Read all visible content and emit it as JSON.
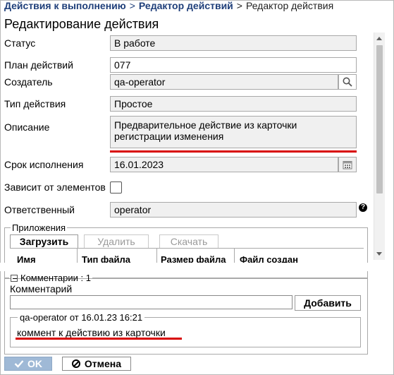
{
  "breadcrumb": {
    "item1": "Действия к выполнению",
    "item2": "Редактор действий",
    "current": "Редактор действия",
    "separator": ">"
  },
  "page_title": "Редактирование действия",
  "form": {
    "status": {
      "label": "Статус",
      "value": "В работе"
    },
    "plan": {
      "label": "План действий",
      "value": "077"
    },
    "creator": {
      "label": "Создатель",
      "value": "qa-operator"
    },
    "action_type": {
      "label": "Тип действия",
      "value": "Простое"
    },
    "description": {
      "label": "Описание",
      "value": "Предварительное действие из карточки регистрации изменения"
    },
    "due_date": {
      "label": "Срок исполнения",
      "value": "16.01.2023"
    },
    "depends": {
      "label": "Зависит от элементов",
      "checked": false
    },
    "responsible": {
      "label": "Ответственный",
      "value": "operator",
      "help": "?"
    }
  },
  "attachments": {
    "legend": "Приложения",
    "buttons": {
      "upload": "Загрузить",
      "delete": "Удалить",
      "download": "Скачать"
    },
    "columns": [
      "Имя",
      "Тип файла",
      "Размер файла",
      "Файл создан"
    ]
  },
  "comments": {
    "legend": "Комментарии : 1",
    "input_label": "Комментарий",
    "input_value": "",
    "add_button": "Добавить",
    "items": [
      {
        "header": "qa-operator от 16.01.23 16:21",
        "text": "коммент к действию из карточки"
      }
    ]
  },
  "footer": {
    "ok": "OK",
    "cancel": "Отмена"
  },
  "colors": {
    "link": "#1f3f7a",
    "highlight": "#d80000",
    "ok_button": "#9fb9d6"
  }
}
